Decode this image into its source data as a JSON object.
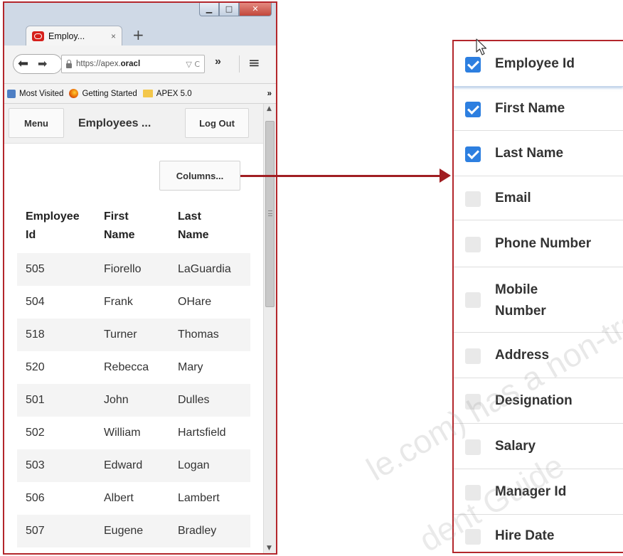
{
  "browser": {
    "tab_title": "Employ...",
    "tab_close": "×",
    "new_tab": "+",
    "url_prefix": "https://apex.",
    "url_bold": "oracl",
    "url_icons": "▽ C",
    "overflow": "»",
    "bookmarks": [
      "Most Visited",
      "Getting Started",
      "APEX 5.0"
    ],
    "bookmarks_more": "»"
  },
  "app": {
    "menu_label": "Menu",
    "title": "Employees ...",
    "logout_label": "Log Out",
    "columns_button": "Columns...",
    "table": {
      "headers": [
        [
          "Employee",
          "Id"
        ],
        [
          "First",
          "Name"
        ],
        [
          "Last",
          "Name"
        ]
      ],
      "rows": [
        [
          "505",
          "Fiorello",
          "LaGuardia"
        ],
        [
          "504",
          "Frank",
          "OHare"
        ],
        [
          "518",
          "Turner",
          "Thomas"
        ],
        [
          "520",
          "Rebecca",
          "Mary"
        ],
        [
          "501",
          "John",
          "Dulles"
        ],
        [
          "502",
          "William",
          "Hartsfield"
        ],
        [
          "503",
          "Edward",
          "Logan"
        ],
        [
          "506",
          "Albert",
          "Lambert"
        ],
        [
          "507",
          "Eugene",
          "Bradley"
        ]
      ]
    }
  },
  "columns_panel": {
    "items": [
      {
        "label": "Employee Id",
        "checked": true
      },
      {
        "label": "First Name",
        "checked": true
      },
      {
        "label": "Last Name",
        "checked": true
      },
      {
        "label": "Email",
        "checked": false
      },
      {
        "label": "Phone Number",
        "checked": false
      },
      {
        "label": "Mobile\nNumber",
        "checked": false
      },
      {
        "label": "Address",
        "checked": false
      },
      {
        "label": "Designation",
        "checked": false
      },
      {
        "label": "Salary",
        "checked": false
      },
      {
        "label": "Manager Id",
        "checked": false
      },
      {
        "label": "Hire Date",
        "checked": false
      }
    ]
  },
  "watermark": {
    "line1": "le.com) has a non-transf",
    "line2": "dent Guide"
  },
  "colors": {
    "frame_red": "#b3262b",
    "checkbox_blue": "#2d7fe0",
    "arrow": "#a01e22"
  }
}
